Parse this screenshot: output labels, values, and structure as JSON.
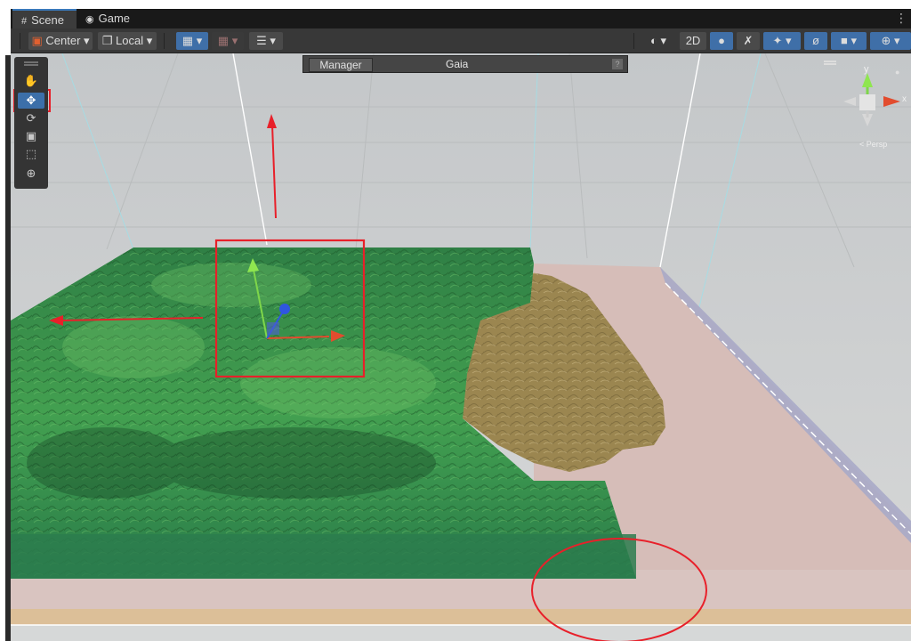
{
  "tabs": [
    {
      "label": "Scene",
      "icon": "scene-grid-icon",
      "active": true
    },
    {
      "label": "Game",
      "icon": "game-controller-icon",
      "active": false
    }
  ],
  "tab_menu": "⋮",
  "toolbar": {
    "pivot_label": "Center",
    "space_label": "Local",
    "mode_2d_label": "2D"
  },
  "overlay": {
    "tab_label": "Manager",
    "title": "Gaia",
    "help": "?"
  },
  "tools": [
    "hand-tool",
    "move-tool",
    "rotate-tool",
    "scale-tool",
    "rect-tool",
    "transform-tool"
  ],
  "gizmo": {
    "y_label": "y",
    "x_label": "x",
    "persp_label": "< Persp"
  },
  "colors": {
    "accent_blue": "#3f6fa8",
    "terrain_green": "#2e8a4e",
    "sand": "#9b8650",
    "annotation_red": "#e8202a"
  }
}
